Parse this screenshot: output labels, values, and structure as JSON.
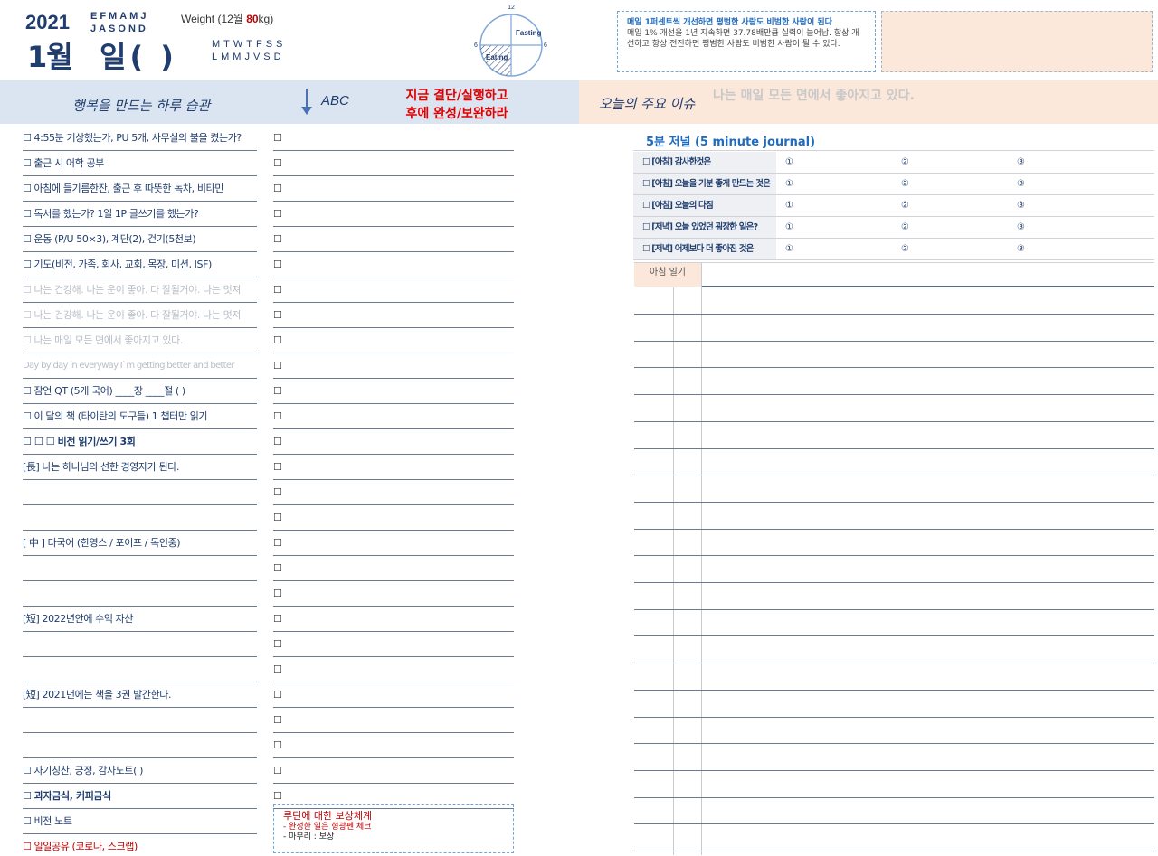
{
  "header": {
    "year": "2021",
    "month": "1월",
    "day": "일(   )",
    "months_top": "EFMAMJ",
    "months_bottom": "JASOND",
    "weight_prefix": "Weight (12월 ",
    "weight_value": "80",
    "weight_suffix": "kg)",
    "days_top": "MTWTFSS",
    "days_bottom": "LMMJVSD"
  },
  "clock": {
    "top": "12",
    "bottom": "12",
    "left": "6",
    "right": "6",
    "fasting": "Fasting",
    "eating": "Eating"
  },
  "quote": {
    "title": "매일 1퍼센트씩 개선하면 평범한 사람도 비범한 사람이 된다",
    "body": "매일 1% 개선을 1년 지속하면 37.78배만큼 실력이 늘어남. 항상 개선하고 항상 전진하면 평범한 사람도 비범한 사람이 될 수 있다."
  },
  "band": {
    "left_title": "행복을 만드는 하루 습관",
    "abc": "ABC",
    "red_title_1": "지금 결단/실행하고",
    "red_title_2": "후에 완성/보완하라",
    "right_title": "오늘의 주요 이슈",
    "right_sub": "나는 매일 모든 면에서 좋아지고 있다."
  },
  "habits": [
    "☐ 4:55분 기상했는가, PU 5개, 사무실의 불을 켰는가?",
    "☐ 출근 시 어학 공부",
    "☐ 아침에 들기름한잔, 출근 후 따뜻한 녹차, 비타민",
    "☐ 독서를 했는가? 1일 1P 글쓰기를 했는가?",
    "☐ 운동 (P/U 50×3), 계단(2), 걷기(5천보)",
    "☐ 기도(비전, 가족, 회사, 교회, 목장, 미션, ISF)",
    "☐ 나는 건강해. 나는 운이 좋아. 다 잘될거야. 나는 멋져",
    "☐ 나는 건강해. 나는 운이 좋아. 다 잘될거야. 나는 멋져",
    "☐ 나는 매일 모든 면에서 좋아지고 있다.",
    "Day by day in everyway I`m getting better and better",
    "☐ 잠언 QT (5개 국어)  ____장 ____절 (              )",
    "☐ 이 달의 책 (타이탄의 도구들) 1 챕터만 읽기",
    "☐ ☐ ☐  비전  읽기/쓰기 3회",
    "[長] 나는 하나님의 선한 경영자가 된다.",
    "",
    "",
    "[ 中 ] 다국어 (한영스 / 포이프 / 독인중)",
    "",
    "",
    "[短] 2022년안에 수익 자산",
    "",
    "",
    "[短] 2021년에는 책을 3권 발간한다.",
    "",
    "",
    "☐ 자기칭찬, 긍정, 감사노트(               )",
    "☐ 과자금식, 커피금식",
    "☐ 비전 노트",
    "☐ 일일공유 (코로나, 스크랩)"
  ],
  "check_mark": "☐",
  "reward": {
    "title": "루틴에 대한 보상체계",
    "line1": "- 완성한 일은 형광펜 체크",
    "line2_prefix": "- ",
    "line2": "마무리 : 보상"
  },
  "journal": {
    "title": "5분 저널 (5 minute journal)",
    "rows": [
      "☐ [아침] 감사한것은",
      "☐ [아침] 오늘을 기분 좋게 만드는 것은",
      "☐ [아침] 오늘의 다짐",
      "☐ [저녁] 오늘 있었던 굉장한 일은?",
      "☐ [저녁] 어제보다 더 좋아진 것은"
    ],
    "n1": "①",
    "n2": "②",
    "n3": "③",
    "morning_diary": "아침 일기"
  }
}
